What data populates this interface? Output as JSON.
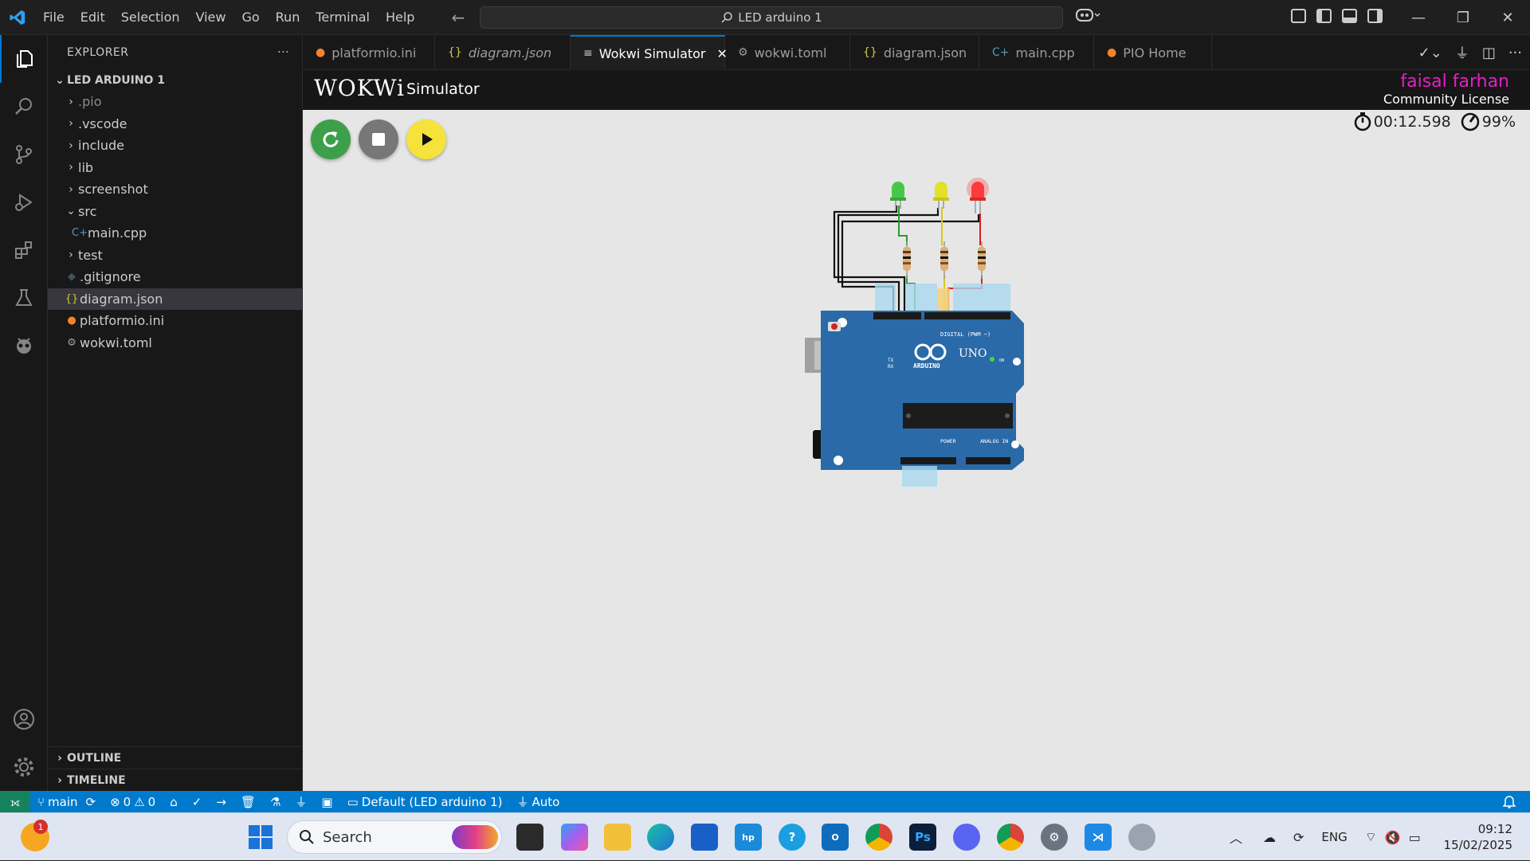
{
  "titlebar": {
    "menu": [
      "File",
      "Edit",
      "Selection",
      "View",
      "Go",
      "Run",
      "Terminal",
      "Help"
    ],
    "search_text": "LED arduino 1"
  },
  "explorer": {
    "title": "EXPLORER",
    "more": "···",
    "folder": "LED ARDUINO 1",
    "items": [
      {
        "label": ".pio",
        "kind": "folder"
      },
      {
        "label": ".vscode",
        "kind": "folder"
      },
      {
        "label": "include",
        "kind": "folder"
      },
      {
        "label": "lib",
        "kind": "folder"
      },
      {
        "label": "screenshot",
        "kind": "folder"
      },
      {
        "label": "src",
        "kind": "folder-open"
      },
      {
        "label": "main.cpp",
        "kind": "cpp"
      },
      {
        "label": "test",
        "kind": "folder"
      },
      {
        "label": ".gitignore",
        "kind": "git"
      },
      {
        "label": "diagram.json",
        "kind": "json"
      },
      {
        "label": "platformio.ini",
        "kind": "pio"
      },
      {
        "label": "wokwi.toml",
        "kind": "toml"
      }
    ],
    "outline": "OUTLINE",
    "timeline": "TIMELINE"
  },
  "tabs": [
    {
      "label": "platformio.ini",
      "icon": "pio-icon"
    },
    {
      "label": "diagram.json",
      "icon": "json-icon"
    },
    {
      "label": "Wokwi Simulator",
      "icon": "preview-icon"
    },
    {
      "label": "wokwi.toml",
      "icon": "gear-icon"
    },
    {
      "label": "diagram.json",
      "icon": "json-icon"
    },
    {
      "label": "main.cpp",
      "icon": "cpp-icon"
    },
    {
      "label": "PIO Home",
      "icon": "pio-icon"
    }
  ],
  "tab_close": "✕",
  "wokwi": {
    "logo": "WOKWi",
    "subtitle": "Simulator",
    "user": "faisal farhan",
    "license": "Community License",
    "timer": "00:12.598",
    "speed": "99%"
  },
  "board": {
    "model": "UNO",
    "brand": "ARDUINO",
    "digital_label": "DIGITAL (PWM ~)",
    "analog_label": "ANALOG IN",
    "power_label": "POWER",
    "on_label": "ON",
    "tx_label": "TX",
    "rx_label": "RX"
  },
  "leds": [
    {
      "color": "#45c84a"
    },
    {
      "color": "#e3e02a"
    },
    {
      "color": "#ff3b3b"
    }
  ],
  "statusbar": {
    "branch": "main",
    "errors": "0",
    "warnings": "0",
    "env": "Default (LED arduino 1)",
    "port": "Auto"
  },
  "taskbar": {
    "search": "Search",
    "notif_count": "1",
    "lang": "ENG",
    "time": "09:12",
    "date": "15/02/2025"
  },
  "colors": {
    "accent": "#0078d4",
    "statusbar": "#007acc",
    "wokwi_user": "#e61ec8",
    "board_blue": "#2a6aa8"
  }
}
